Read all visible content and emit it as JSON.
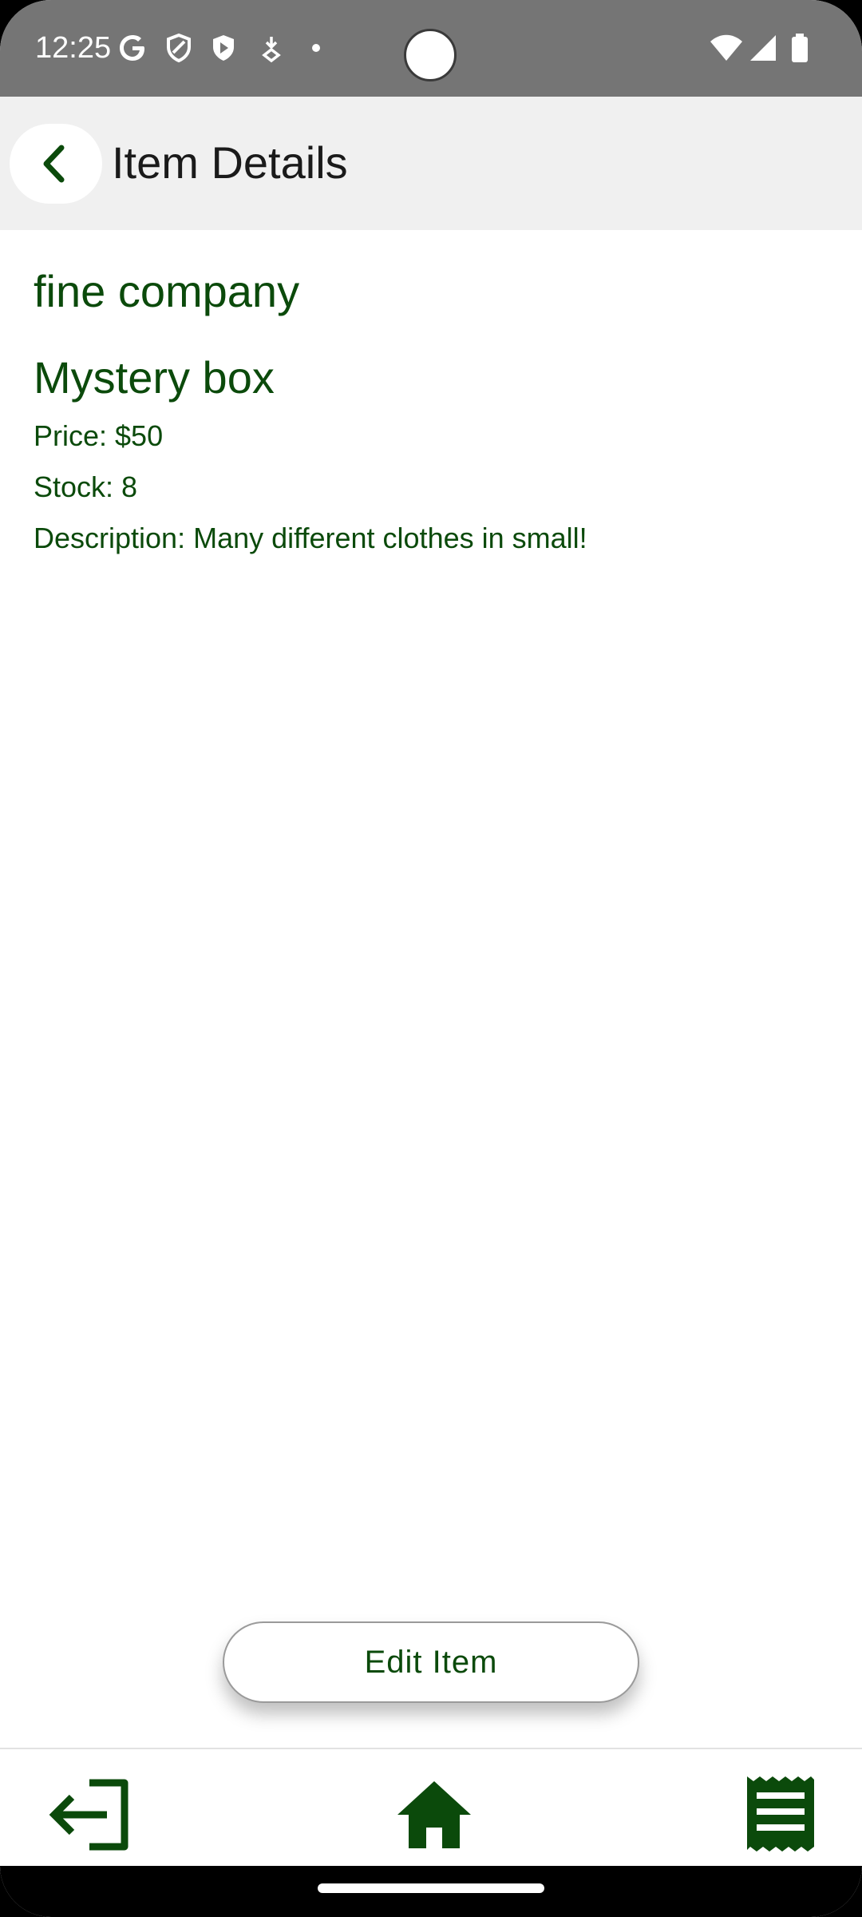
{
  "status_bar": {
    "time": "12:25",
    "icons": [
      "google-icon",
      "shield-icon",
      "play-protect-icon",
      "download-icon",
      "dot-icon",
      "wifi-icon",
      "signal-icon",
      "battery-icon"
    ]
  },
  "app_bar": {
    "title": "Item Details",
    "back_icon": "chevron-left-icon"
  },
  "item": {
    "company": "fine company",
    "name": "Mystery box",
    "price_label": "Price:",
    "price": "$50",
    "stock_label": "Stock:",
    "stock": "8",
    "description_label": "Description:",
    "description": "Many different clothes in small!"
  },
  "actions": {
    "edit_label": "Edit Item"
  },
  "bottom_nav": {
    "items": [
      "logout-icon",
      "home-icon",
      "orders-icon"
    ]
  },
  "colors": {
    "accent": "#0b4a0b",
    "status_bar": "#757575",
    "app_bar": "#f0f0f0"
  }
}
